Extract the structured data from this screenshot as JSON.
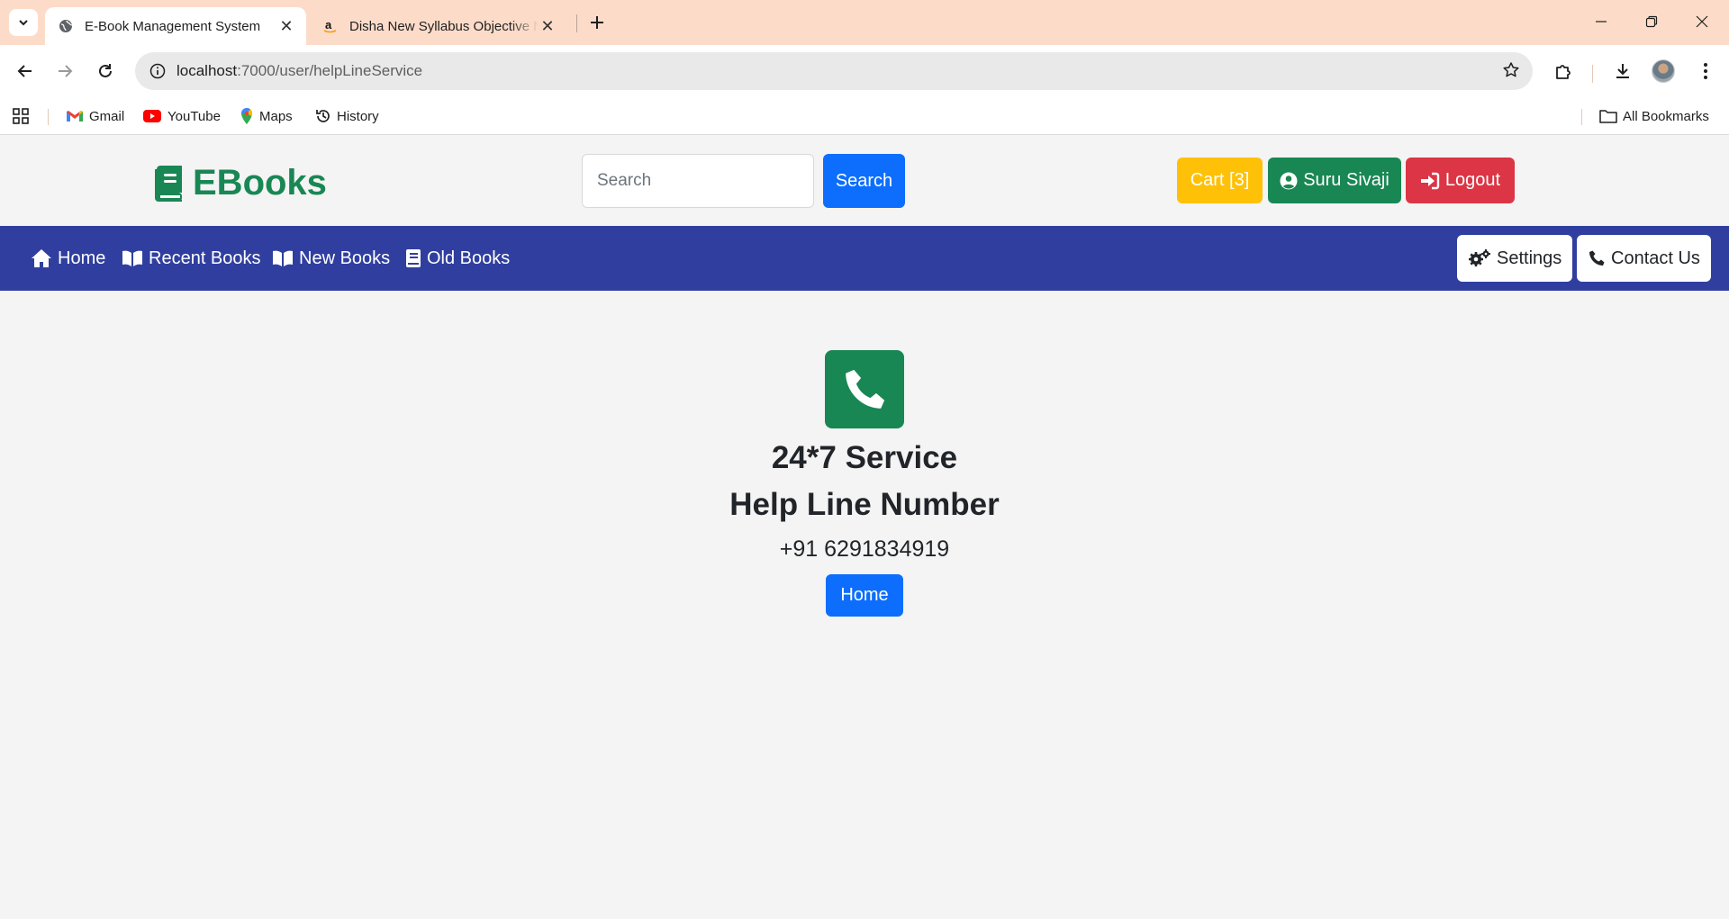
{
  "browser": {
    "tabs": [
      {
        "title": "E-Book Management System",
        "active": true,
        "favicon": "globe-icon"
      },
      {
        "title": "Disha New Syllabus Objective NCERT Xtract",
        "active": false,
        "favicon": "amazon-icon"
      }
    ],
    "url_host": "localhost",
    "url_path": ":7000/user/helpLineService",
    "bookmarks": [
      {
        "label": "Gmail",
        "icon": "gmail-icon"
      },
      {
        "label": "YouTube",
        "icon": "youtube-icon"
      },
      {
        "label": "Maps",
        "icon": "maps-icon"
      },
      {
        "label": "History",
        "icon": "history-icon"
      }
    ],
    "all_bookmarks_label": "All Bookmarks"
  },
  "header": {
    "logo_text": "EBooks",
    "search_placeholder": "Search",
    "search_button": "Search",
    "cart_label": "Cart [3]",
    "user_label": "Suru Sivaji",
    "logout_label": "Logout"
  },
  "nav": {
    "links": [
      {
        "label": "Home",
        "icon": "home-icon"
      },
      {
        "label": "Recent Books",
        "icon": "book-open-icon"
      },
      {
        "label": "New Books",
        "icon": "book-open-icon"
      },
      {
        "label": "Old Books",
        "icon": "book-icon"
      }
    ],
    "settings_label": "Settings",
    "contact_label": "Contact Us"
  },
  "helpline": {
    "title": "24*7 Service",
    "subtitle": "Help Line Number",
    "phone": "+91 6291834919",
    "home_button": "Home"
  },
  "colors": {
    "brand_green": "#198754",
    "nav_blue": "#303f9f",
    "primary_blue": "#0d6efd",
    "warning_yellow": "#ffc107",
    "danger_red": "#dc3545",
    "tabstrip": "#fcdcc9"
  }
}
